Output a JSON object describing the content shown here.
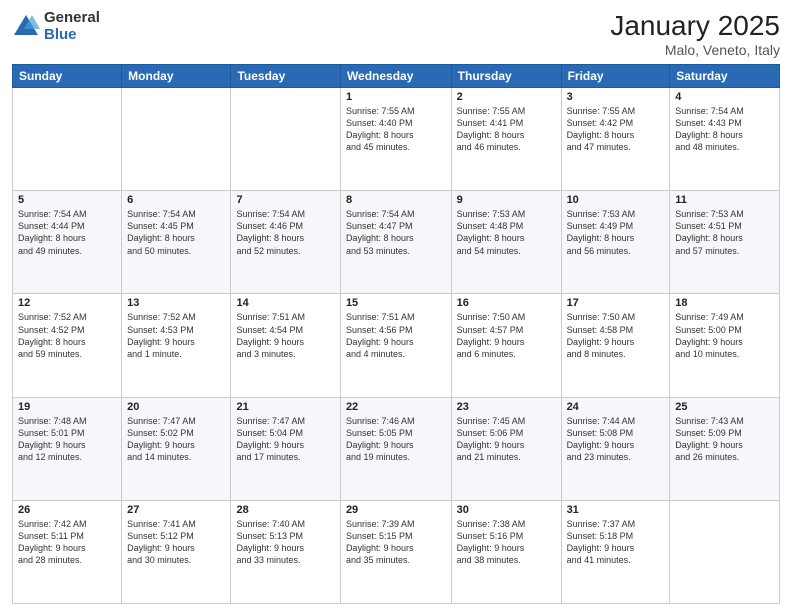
{
  "logo": {
    "general": "General",
    "blue": "Blue"
  },
  "header": {
    "title": "January 2025",
    "subtitle": "Malo, Veneto, Italy"
  },
  "weekdays": [
    "Sunday",
    "Monday",
    "Tuesday",
    "Wednesday",
    "Thursday",
    "Friday",
    "Saturday"
  ],
  "weeks": [
    [
      {
        "day": "",
        "info": ""
      },
      {
        "day": "",
        "info": ""
      },
      {
        "day": "",
        "info": ""
      },
      {
        "day": "1",
        "info": "Sunrise: 7:55 AM\nSunset: 4:40 PM\nDaylight: 8 hours\nand 45 minutes."
      },
      {
        "day": "2",
        "info": "Sunrise: 7:55 AM\nSunset: 4:41 PM\nDaylight: 8 hours\nand 46 minutes."
      },
      {
        "day": "3",
        "info": "Sunrise: 7:55 AM\nSunset: 4:42 PM\nDaylight: 8 hours\nand 47 minutes."
      },
      {
        "day": "4",
        "info": "Sunrise: 7:54 AM\nSunset: 4:43 PM\nDaylight: 8 hours\nand 48 minutes."
      }
    ],
    [
      {
        "day": "5",
        "info": "Sunrise: 7:54 AM\nSunset: 4:44 PM\nDaylight: 8 hours\nand 49 minutes."
      },
      {
        "day": "6",
        "info": "Sunrise: 7:54 AM\nSunset: 4:45 PM\nDaylight: 8 hours\nand 50 minutes."
      },
      {
        "day": "7",
        "info": "Sunrise: 7:54 AM\nSunset: 4:46 PM\nDaylight: 8 hours\nand 52 minutes."
      },
      {
        "day": "8",
        "info": "Sunrise: 7:54 AM\nSunset: 4:47 PM\nDaylight: 8 hours\nand 53 minutes."
      },
      {
        "day": "9",
        "info": "Sunrise: 7:53 AM\nSunset: 4:48 PM\nDaylight: 8 hours\nand 54 minutes."
      },
      {
        "day": "10",
        "info": "Sunrise: 7:53 AM\nSunset: 4:49 PM\nDaylight: 8 hours\nand 56 minutes."
      },
      {
        "day": "11",
        "info": "Sunrise: 7:53 AM\nSunset: 4:51 PM\nDaylight: 8 hours\nand 57 minutes."
      }
    ],
    [
      {
        "day": "12",
        "info": "Sunrise: 7:52 AM\nSunset: 4:52 PM\nDaylight: 8 hours\nand 59 minutes."
      },
      {
        "day": "13",
        "info": "Sunrise: 7:52 AM\nSunset: 4:53 PM\nDaylight: 9 hours\nand 1 minute."
      },
      {
        "day": "14",
        "info": "Sunrise: 7:51 AM\nSunset: 4:54 PM\nDaylight: 9 hours\nand 3 minutes."
      },
      {
        "day": "15",
        "info": "Sunrise: 7:51 AM\nSunset: 4:56 PM\nDaylight: 9 hours\nand 4 minutes."
      },
      {
        "day": "16",
        "info": "Sunrise: 7:50 AM\nSunset: 4:57 PM\nDaylight: 9 hours\nand 6 minutes."
      },
      {
        "day": "17",
        "info": "Sunrise: 7:50 AM\nSunset: 4:58 PM\nDaylight: 9 hours\nand 8 minutes."
      },
      {
        "day": "18",
        "info": "Sunrise: 7:49 AM\nSunset: 5:00 PM\nDaylight: 9 hours\nand 10 minutes."
      }
    ],
    [
      {
        "day": "19",
        "info": "Sunrise: 7:48 AM\nSunset: 5:01 PM\nDaylight: 9 hours\nand 12 minutes."
      },
      {
        "day": "20",
        "info": "Sunrise: 7:47 AM\nSunset: 5:02 PM\nDaylight: 9 hours\nand 14 minutes."
      },
      {
        "day": "21",
        "info": "Sunrise: 7:47 AM\nSunset: 5:04 PM\nDaylight: 9 hours\nand 17 minutes."
      },
      {
        "day": "22",
        "info": "Sunrise: 7:46 AM\nSunset: 5:05 PM\nDaylight: 9 hours\nand 19 minutes."
      },
      {
        "day": "23",
        "info": "Sunrise: 7:45 AM\nSunset: 5:06 PM\nDaylight: 9 hours\nand 21 minutes."
      },
      {
        "day": "24",
        "info": "Sunrise: 7:44 AM\nSunset: 5:08 PM\nDaylight: 9 hours\nand 23 minutes."
      },
      {
        "day": "25",
        "info": "Sunrise: 7:43 AM\nSunset: 5:09 PM\nDaylight: 9 hours\nand 26 minutes."
      }
    ],
    [
      {
        "day": "26",
        "info": "Sunrise: 7:42 AM\nSunset: 5:11 PM\nDaylight: 9 hours\nand 28 minutes."
      },
      {
        "day": "27",
        "info": "Sunrise: 7:41 AM\nSunset: 5:12 PM\nDaylight: 9 hours\nand 30 minutes."
      },
      {
        "day": "28",
        "info": "Sunrise: 7:40 AM\nSunset: 5:13 PM\nDaylight: 9 hours\nand 33 minutes."
      },
      {
        "day": "29",
        "info": "Sunrise: 7:39 AM\nSunset: 5:15 PM\nDaylight: 9 hours\nand 35 minutes."
      },
      {
        "day": "30",
        "info": "Sunrise: 7:38 AM\nSunset: 5:16 PM\nDaylight: 9 hours\nand 38 minutes."
      },
      {
        "day": "31",
        "info": "Sunrise: 7:37 AM\nSunset: 5:18 PM\nDaylight: 9 hours\nand 41 minutes."
      },
      {
        "day": "",
        "info": ""
      }
    ]
  ]
}
